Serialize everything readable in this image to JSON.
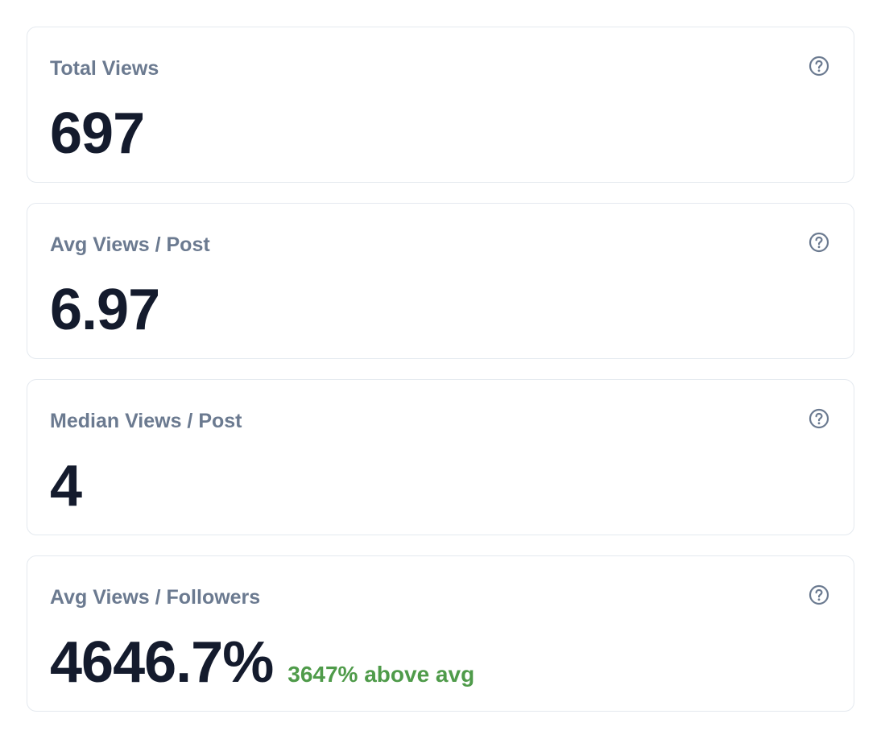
{
  "metrics": [
    {
      "label": "Total Views",
      "value": "697",
      "delta": "",
      "help_icon": "help-circle-icon"
    },
    {
      "label": "Avg Views / Post",
      "value": "6.97",
      "delta": "",
      "help_icon": "help-circle-icon"
    },
    {
      "label": "Median Views / Post",
      "value": "4",
      "delta": "",
      "help_icon": "help-circle-icon"
    },
    {
      "label": "Avg Views / Followers",
      "value": "4646.7%",
      "delta": "3647% above avg",
      "help_icon": "help-circle-icon"
    }
  ],
  "colors": {
    "label": "#6b7a90",
    "value": "#141b2d",
    "positive_delta": "#4f9b4a",
    "border": "#e4e9ef",
    "icon": "#6b7a90"
  }
}
